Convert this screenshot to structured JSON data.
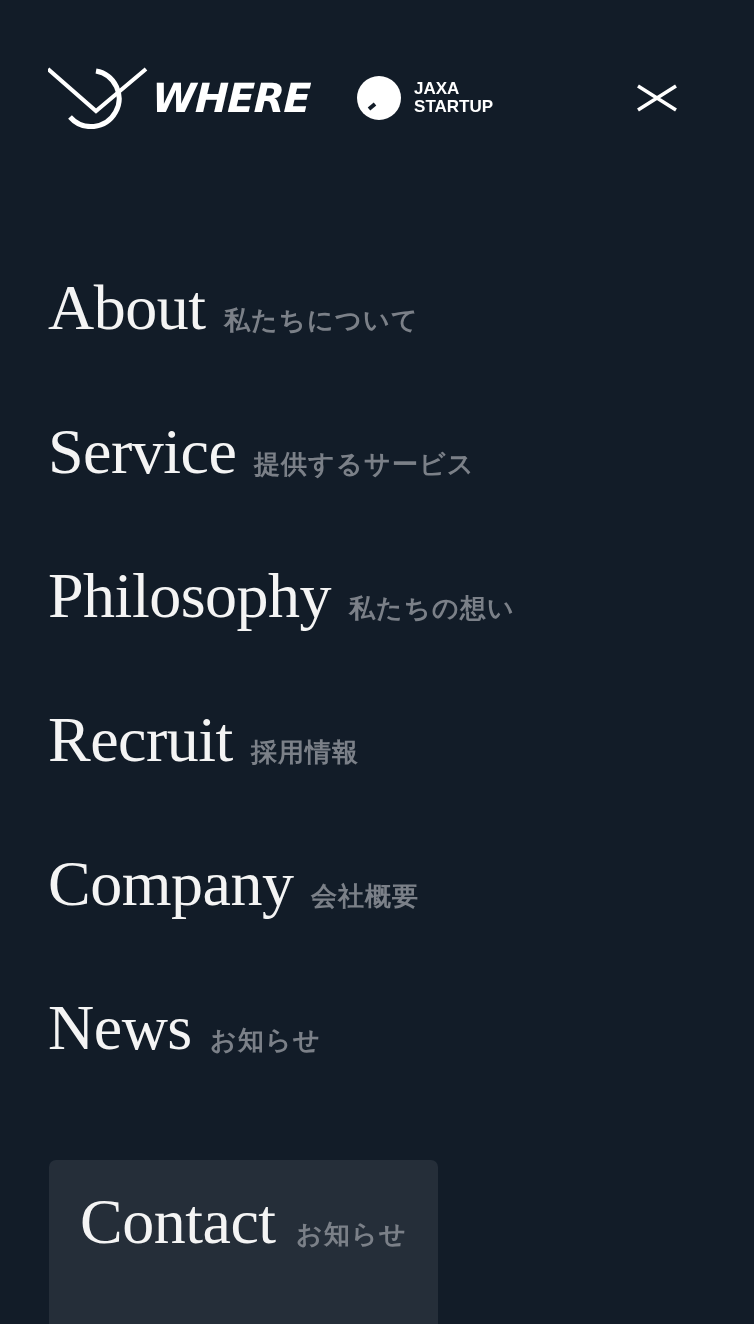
{
  "header": {
    "logo": "WHERE",
    "partner": [
      "JAXA",
      "STARTUP"
    ]
  },
  "nav": [
    {
      "label": "About",
      "sub": "私たちについて"
    },
    {
      "label": "Service",
      "sub": "提供するサービス"
    },
    {
      "label": "Philosophy",
      "sub": "私たちの想い"
    },
    {
      "label": "Recruit",
      "sub": "採用情報"
    },
    {
      "label": "Company",
      "sub": "会社概要"
    },
    {
      "label": "News",
      "sub": "お知らせ"
    }
  ],
  "contact": {
    "label": "Contact",
    "sub": "お知らせ"
  }
}
